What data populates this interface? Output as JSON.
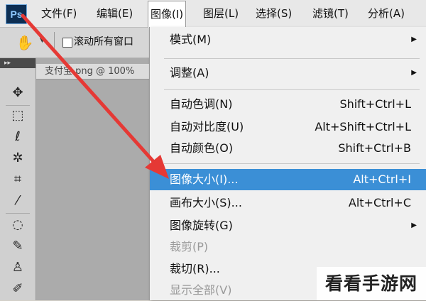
{
  "app": {
    "logo_text": "Ps"
  },
  "menubar": {
    "items": [
      "文件(F)",
      "编辑(E)",
      "图像(I)",
      "图层(L)",
      "选择(S)",
      "滤镜(T)",
      "分析(A)"
    ],
    "active_index": 2
  },
  "options_bar": {
    "scroll_all_windows_label": "滚动所有窗口",
    "scroll_all_windows_checked": false
  },
  "document": {
    "tab_title": "支付宝.png @ 100%"
  },
  "image_menu": {
    "items": [
      {
        "label": "模式(M)",
        "shortcut": "",
        "submenu": true,
        "enabled": true,
        "selected": false
      },
      {
        "label": "调整(A)",
        "shortcut": "",
        "submenu": true,
        "enabled": true,
        "selected": false
      },
      {
        "label": "自动色调(N)",
        "shortcut": "Shift+Ctrl+L",
        "submenu": false,
        "enabled": true,
        "selected": false
      },
      {
        "label": "自动对比度(U)",
        "shortcut": "Alt+Shift+Ctrl+L",
        "submenu": false,
        "enabled": true,
        "selected": false
      },
      {
        "label": "自动颜色(O)",
        "shortcut": "Shift+Ctrl+B",
        "submenu": false,
        "enabled": true,
        "selected": false
      },
      {
        "label": "图像大小(I)...",
        "shortcut": "Alt+Ctrl+I",
        "submenu": false,
        "enabled": true,
        "selected": true
      },
      {
        "label": "画布大小(S)...",
        "shortcut": "Alt+Ctrl+C",
        "submenu": false,
        "enabled": true,
        "selected": false
      },
      {
        "label": "图像旋转(G)",
        "shortcut": "",
        "submenu": true,
        "enabled": true,
        "selected": false
      },
      {
        "label": "裁剪(P)",
        "shortcut": "",
        "submenu": false,
        "enabled": false,
        "selected": false
      },
      {
        "label": "裁切(R)...",
        "shortcut": "",
        "submenu": false,
        "enabled": true,
        "selected": false
      },
      {
        "label": "显示全部(V)",
        "shortcut": "",
        "submenu": false,
        "enabled": false,
        "selected": false
      }
    ]
  },
  "tools": [
    "move-tool-icon",
    "marquee-tool-icon",
    "lasso-tool-icon",
    "magic-wand-tool-icon",
    "crop-tool-icon",
    "eyedropper-tool-icon",
    "spot-healing-tool-icon",
    "brush-tool-icon",
    "stamp-tool-icon",
    "history-brush-tool-icon"
  ],
  "colors": {
    "highlight": "#3b8fd6",
    "annotation_arrow": "#e53935"
  },
  "watermark": "看看手游网"
}
